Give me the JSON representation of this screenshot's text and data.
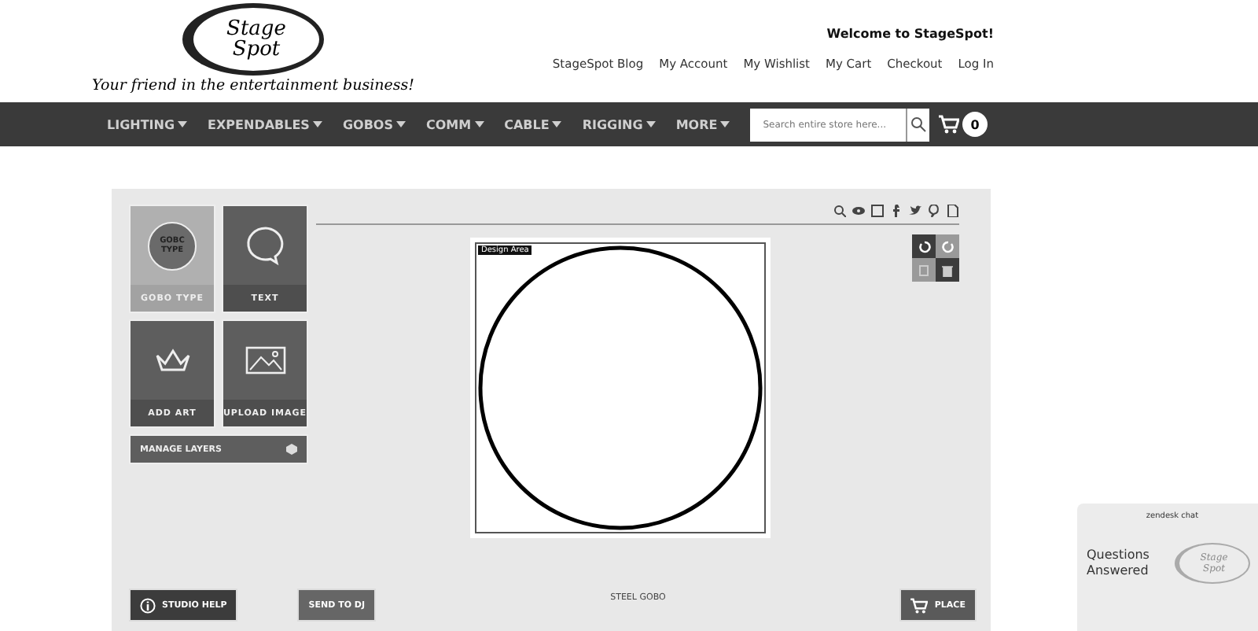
{
  "logo": {
    "line_1": "Stage",
    "line_2": "Spot",
    "tagline": "Your friend in the entertainment business!"
  },
  "header": {
    "welcome": "Welcome to StageSpot!",
    "links": [
      "StageSpot Blog",
      "My Account",
      "My Wishlist",
      "My Cart",
      "Checkout",
      "Log In"
    ]
  },
  "nav": {
    "items": [
      "LIGHTING",
      "EXPENDABLES",
      "GOBOS",
      "COMM",
      "CABLE",
      "RIGGING",
      "MORE"
    ],
    "search": {
      "placeholder": "Search entire store here..."
    },
    "cart_count": "0"
  },
  "studio": {
    "tools": [
      {
        "kind": "gobo",
        "label": "GOBO TYPE",
        "badge": "GOBC TYPE",
        "selected": true
      },
      {
        "kind": "text",
        "label": "TEXT",
        "selected": false
      },
      {
        "kind": "art",
        "label": "ADD ART",
        "selected": false
      },
      {
        "kind": "image",
        "label": "UPLOAD IMAGE",
        "selected": false
      }
    ],
    "manage_layers": "MANAGE LAYERS",
    "design_area_label": "Design Area",
    "product": "STEEL GOBO",
    "buttons": {
      "help": "STUDIO HELP",
      "send": "SEND TO DJ",
      "place": "PLACE"
    }
  },
  "chat": {
    "title": "zendesk chat",
    "message": "Questions Answered",
    "logo_line_1": "Stage",
    "logo_line_2": "Spot"
  }
}
